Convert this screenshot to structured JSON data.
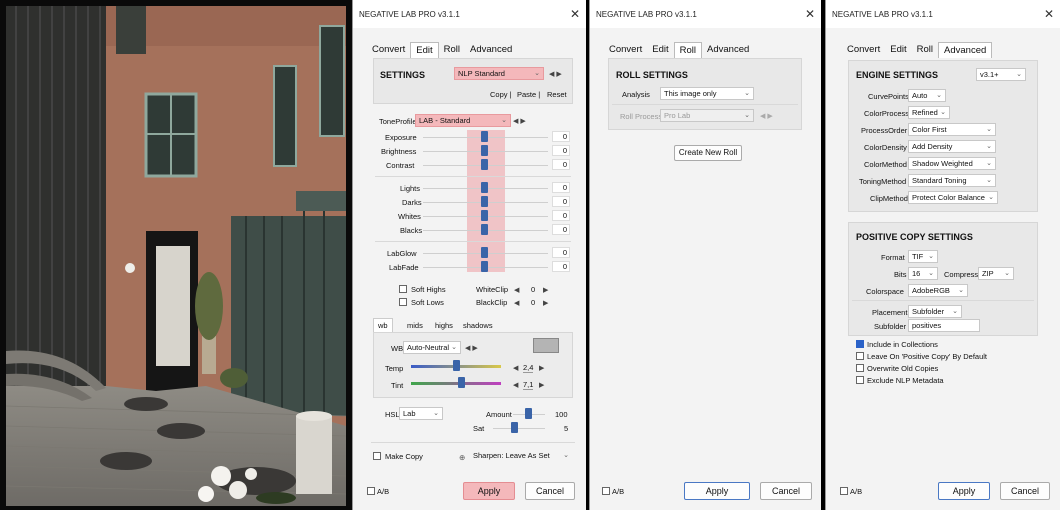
{
  "photo": {
    "description_icon": "photo-icon"
  },
  "edit_window": {
    "title": "NEGATIVE LAB PRO v3.1.1",
    "tabs": [
      "Convert",
      "Edit",
      "Roll",
      "Advanced"
    ],
    "settings_label": "SETTINGS",
    "preset_value": "NLP Standard",
    "copy": "Copy |",
    "paste": "Paste |",
    "reset": "Reset",
    "toneprofile_label": "ToneProfile",
    "toneprofile_value": "LAB - Standard",
    "sliders_a": [
      {
        "label": "Exposure",
        "value": "0"
      },
      {
        "label": "Brightness",
        "value": "0"
      },
      {
        "label": "Contrast",
        "value": "0"
      }
    ],
    "sliders_b": [
      {
        "label": "Lights",
        "value": "0"
      },
      {
        "label": "Darks",
        "value": "0"
      },
      {
        "label": "Whites",
        "value": "0"
      },
      {
        "label": "Blacks",
        "value": "0"
      }
    ],
    "sliders_c": [
      {
        "label": "LabGlow",
        "value": "0"
      },
      {
        "label": "LabFade",
        "value": "0"
      }
    ],
    "soft_highs": "Soft Highs",
    "soft_lows": "Soft Lows",
    "whiteclip_label": "WhiteClip",
    "whiteclip_value": "0",
    "blackclip_label": "BlackClip",
    "blackclip_value": "0",
    "color_tabs": [
      "wb",
      "mids",
      "highs",
      "shadows"
    ],
    "wb_label": "WB",
    "wb_value": "Auto-Neutral",
    "temp_label": "Temp",
    "temp_value": "2,4",
    "tint_label": "Tint",
    "tint_value": "7,1",
    "hsl_label": "HSL",
    "hsl_value": "Lab",
    "amount_label": "Amount",
    "amount_value": "100",
    "sat_label": "Sat",
    "sat_value": "5",
    "make_copy": "Make Copy",
    "sharpen_value": "Sharpen: Leave As Set",
    "ab": "A/B",
    "apply": "Apply",
    "cancel": "Cancel"
  },
  "roll_window": {
    "title": "NEGATIVE LAB PRO v3.1.1",
    "tabs": [
      "Convert",
      "Edit",
      "Roll",
      "Advanced"
    ],
    "roll_settings": "ROLL SETTINGS",
    "analysis_label": "Analysis",
    "analysis_value": "This image only",
    "roll_process_label": "Roll Process",
    "roll_process_value": "Pro Lab",
    "create_new_roll": "Create New Roll",
    "ab": "A/B",
    "apply": "Apply",
    "cancel": "Cancel"
  },
  "advanced_window": {
    "title": "NEGATIVE LAB PRO v3.1.1",
    "tabs": [
      "Convert",
      "Edit",
      "Roll",
      "Advanced"
    ],
    "engine_settings": "ENGINE SETTINGS",
    "engine_version": "v3.1+",
    "engine_rows": [
      {
        "label": "CurvePoints",
        "value": "Auto"
      },
      {
        "label": "ColorProcess",
        "value": "Refined"
      },
      {
        "label": "ProcessOrder",
        "value": "Color First"
      },
      {
        "label": "ColorDensity",
        "value": "Add Density"
      },
      {
        "label": "ColorMethod",
        "value": "Shadow Weighted"
      },
      {
        "label": "ToningMethod",
        "value": "Standard Toning"
      },
      {
        "label": "ClipMethod",
        "value": "Protect Color Balance"
      }
    ],
    "positive_copy_settings": "POSITIVE COPY SETTINGS",
    "format_label": "Format",
    "format_value": "TIF",
    "bits_label": "Bits",
    "bits_value": "16",
    "compress_label": "Compress",
    "compress_value": "ZIP",
    "colorspace_label": "Colorspace",
    "colorspace_value": "AdobeRGB",
    "placement_label": "Placement",
    "placement_value": "Subfolder",
    "subfolder_label": "Subfolder",
    "subfolder_value": "positives",
    "checks": [
      {
        "label": "Include in Collections",
        "checked": true
      },
      {
        "label": "Leave On 'Positive Copy' By Default",
        "checked": false
      },
      {
        "label": "Overwrite Old Copies",
        "checked": false
      },
      {
        "label": "Exclude NLP Metadata",
        "checked": false
      }
    ],
    "ab": "A/B",
    "apply": "Apply",
    "cancel": "Cancel"
  }
}
